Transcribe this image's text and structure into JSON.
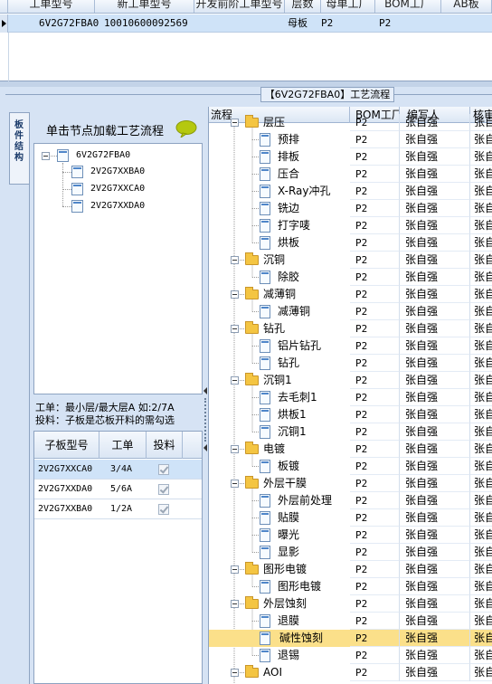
{
  "top_grid": {
    "headers": [
      "工单型号",
      "新工单型号",
      "开发前阶工单型号",
      "层数",
      "母单工厂",
      "BOM工厂",
      "AB板"
    ],
    "row": {
      "model": "6V2G72FBA0",
      "code": "10010600092569",
      "type": "母板",
      "factory": "P2",
      "bom": "P2"
    }
  },
  "title_label": "【6V2G72FBA0】工艺流程",
  "vertical_tab_label": "板件结构",
  "left_panel": {
    "header_label": "单击节点加载工艺流程",
    "tree": {
      "root": "6V2G72FBA0",
      "children": [
        "2V2G7XXBA0",
        "2V2G7XXCA0",
        "2V2G7XXDA0"
      ]
    },
    "info_lines": [
      "工单：最小层/最大层A 如:2/7A",
      "投料：子板是芯板开料的需勾选"
    ],
    "grid": {
      "headers": [
        "子板型号",
        "工单",
        "投料"
      ],
      "rows": [
        {
          "model": "2V2G7XXCA0",
          "order": "3/4A",
          "feed": true
        },
        {
          "model": "2V2G7XXDA0",
          "order": "5/6A",
          "feed": true
        },
        {
          "model": "2V2G7XXBA0",
          "order": "1/2A",
          "feed": true
        }
      ]
    }
  },
  "process_grid": {
    "headers": [
      "流程",
      "BOM工厂",
      "编写人",
      "核审"
    ],
    "rows": [
      {
        "name": "层压",
        "level": 0,
        "bom": "P2",
        "writer": "张自强",
        "extra": "张自"
      },
      {
        "name": "预排",
        "level": 1,
        "bom": "P2",
        "writer": "张自强",
        "extra": "张自"
      },
      {
        "name": "排板",
        "level": 1,
        "bom": "P2",
        "writer": "张自强",
        "extra": "张自"
      },
      {
        "name": "压合",
        "level": 1,
        "bom": "P2",
        "writer": "张自强",
        "extra": "张自"
      },
      {
        "name": "X-Ray冲孔",
        "level": 1,
        "bom": "P2",
        "writer": "张自强",
        "extra": "张自"
      },
      {
        "name": "铣边",
        "level": 1,
        "bom": "P2",
        "writer": "张自强",
        "extra": "张自"
      },
      {
        "name": "打字唛",
        "level": 1,
        "bom": "P2",
        "writer": "张自强",
        "extra": "张自"
      },
      {
        "name": "烘板",
        "level": 1,
        "bom": "P2",
        "writer": "张自强",
        "extra": "张自"
      },
      {
        "name": "沉铜",
        "level": 0,
        "bom": "P2",
        "writer": "张自强",
        "extra": "张自"
      },
      {
        "name": "除胶",
        "level": 1,
        "bom": "P2",
        "writer": "张自强",
        "extra": "张自"
      },
      {
        "name": "减薄铜",
        "level": 0,
        "bom": "P2",
        "writer": "张自强",
        "extra": "张自"
      },
      {
        "name": "减薄铜",
        "level": 1,
        "bom": "P2",
        "writer": "张自强",
        "extra": "张自"
      },
      {
        "name": "钻孔",
        "level": 0,
        "bom": "P2",
        "writer": "张自强",
        "extra": "张自"
      },
      {
        "name": "铝片钻孔",
        "level": 1,
        "bom": "P2",
        "writer": "张自强",
        "extra": "张自"
      },
      {
        "name": "钻孔",
        "level": 1,
        "bom": "P2",
        "writer": "张自强",
        "extra": "张自"
      },
      {
        "name": "沉铜1",
        "level": 0,
        "bom": "P2",
        "writer": "张自强",
        "extra": "张自"
      },
      {
        "name": "去毛刺1",
        "level": 1,
        "bom": "P2",
        "writer": "张自强",
        "extra": "张自"
      },
      {
        "name": "烘板1",
        "level": 1,
        "bom": "P2",
        "writer": "张自强",
        "extra": "张自"
      },
      {
        "name": "沉铜1",
        "level": 1,
        "bom": "P2",
        "writer": "张自强",
        "extra": "张自"
      },
      {
        "name": "电镀",
        "level": 0,
        "bom": "P2",
        "writer": "张自强",
        "extra": "张自"
      },
      {
        "name": "板镀",
        "level": 1,
        "bom": "P2",
        "writer": "张自强",
        "extra": "张自"
      },
      {
        "name": "外层干膜",
        "level": 0,
        "bom": "P2",
        "writer": "张自强",
        "extra": "张自"
      },
      {
        "name": "外层前处理",
        "level": 1,
        "bom": "P2",
        "writer": "张自强",
        "extra": "张自"
      },
      {
        "name": "贴膜",
        "level": 1,
        "bom": "P2",
        "writer": "张自强",
        "extra": "张自"
      },
      {
        "name": "曝光",
        "level": 1,
        "bom": "P2",
        "writer": "张自强",
        "extra": "张自"
      },
      {
        "name": "显影",
        "level": 1,
        "bom": "P2",
        "writer": "张自强",
        "extra": "张自"
      },
      {
        "name": "图形电镀",
        "level": 0,
        "bom": "P2",
        "writer": "张自强",
        "extra": "张自"
      },
      {
        "name": "图形电镀",
        "level": 1,
        "bom": "P2",
        "writer": "张自强",
        "extra": "张自"
      },
      {
        "name": "外层蚀刻",
        "level": 0,
        "bom": "P2",
        "writer": "张自强",
        "extra": "张自"
      },
      {
        "name": "退膜",
        "level": 1,
        "bom": "P2",
        "writer": "张自强",
        "extra": "张自"
      },
      {
        "name": "碱性蚀刻",
        "level": 1,
        "bom": "P2",
        "writer": "张自强",
        "extra": "张自",
        "selected": true
      },
      {
        "name": "退锡",
        "level": 1,
        "bom": "P2",
        "writer": "张自强",
        "extra": "张自"
      },
      {
        "name": "AOI",
        "level": 0,
        "bom": "P2",
        "writer": "张自强",
        "extra": "张自"
      }
    ]
  },
  "colors": {
    "accent": "#d6e3f4",
    "selection": "#cfe3f8",
    "highlight": "#fbe08a",
    "folder": "#f4c542"
  },
  "icons": {
    "speech_bubble": "speech-bubble-icon",
    "folder": "folder-icon",
    "document": "document-icon"
  }
}
